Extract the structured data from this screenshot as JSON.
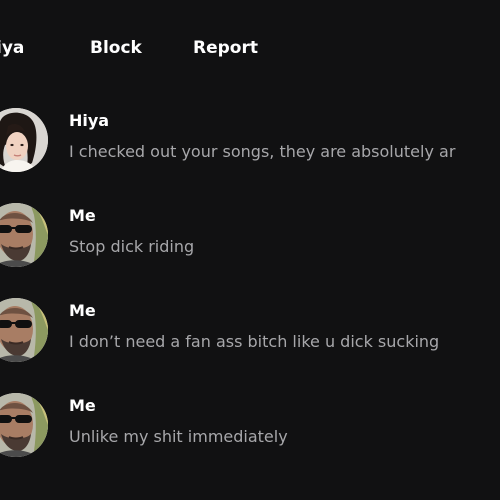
{
  "header": {
    "name_tab": "iya",
    "block_label": "Block",
    "report_label": "Report"
  },
  "messages": [
    {
      "sender": "Hiya",
      "text": "I checked out your songs, they are absolutely ar",
      "avatar": "woman-portrait-avatar"
    },
    {
      "sender": "Me",
      "text": "Stop dick riding",
      "avatar": "man-sunglasses-avatar"
    },
    {
      "sender": "Me",
      "text": "I don’t need a fan ass bitch like u dick sucking",
      "avatar": "man-sunglasses-avatar"
    },
    {
      "sender": "Me",
      "text": "Unlike my shit immediately",
      "avatar": "man-sunglasses-avatar"
    }
  ],
  "colors": {
    "background": "#111112",
    "primary_text": "#ffffff",
    "secondary_text": "#a7a7aa"
  }
}
